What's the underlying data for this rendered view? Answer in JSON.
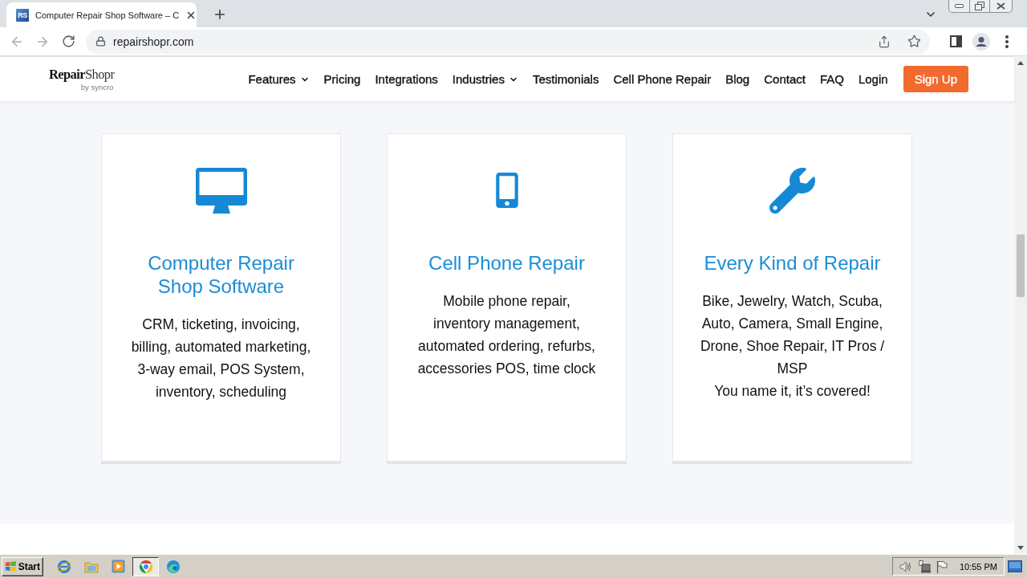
{
  "browser": {
    "tabs": [
      {
        "favicon": "RS",
        "title": "Computer Repair Shop Software – C",
        "selected": true
      }
    ],
    "nav_buttons": [
      {
        "kind": "back",
        "disabled": true
      },
      {
        "kind": "forward",
        "disabled": true
      },
      {
        "kind": "reload",
        "disabled": false
      }
    ],
    "address": {
      "url": "repairshopr.com"
    }
  },
  "site_header": {
    "logo": {
      "name": "**Repair**Shopr",
      "tagline": "by syncro"
    },
    "menu": [
      {
        "label": "Features",
        "dropdown": true
      },
      {
        "label": "Pricing",
        "dropdown": false
      },
      {
        "label": "Integrations",
        "dropdown": false
      },
      {
        "label": "Industries",
        "dropdown": true
      },
      {
        "label": "Testimonials",
        "dropdown": false
      },
      {
        "label": "Cell Phone Repair",
        "dropdown": false
      },
      {
        "label": "Blog",
        "dropdown": false
      },
      {
        "label": "Contact",
        "dropdown": false
      },
      {
        "label": "FAQ",
        "dropdown": false
      },
      {
        "label": "Login",
        "dropdown": false
      }
    ],
    "signup_button": "Sign Up"
  },
  "cards": [
    {
      "title": "Computer Repair Shop Software",
      "description": [
        "CRM, ticketing, invoicing,",
        "billing, automated marketing,",
        "3-way email, POS System,",
        "inventory, scheduling"
      ]
    },
    {
      "title": "Cell Phone Repair",
      "description": [
        "Mobile phone repair,",
        "inventory management,",
        "automated ordering, refurbs,",
        "accessories POS, time clock"
      ]
    },
    {
      "title": "Every Kind of Repair",
      "description": [
        "Bike, Jewelry, Watch, Scuba,",
        "Auto, Camera, Small Engine,",
        "Drone, Shoe Repair, IT Pros /",
        "MSP",
        "You name it, it’s covered!"
      ]
    }
  ],
  "taskbar": {
    "start_label": "Start",
    "apps": [
      {
        "kind": "ie",
        "selected": false
      },
      {
        "kind": "folder",
        "selected": false
      },
      {
        "kind": "player",
        "selected": false
      },
      {
        "kind": "chrome",
        "selected": true
      },
      {
        "kind": "edge",
        "selected": false
      }
    ],
    "clock": "10:55 PM"
  }
}
